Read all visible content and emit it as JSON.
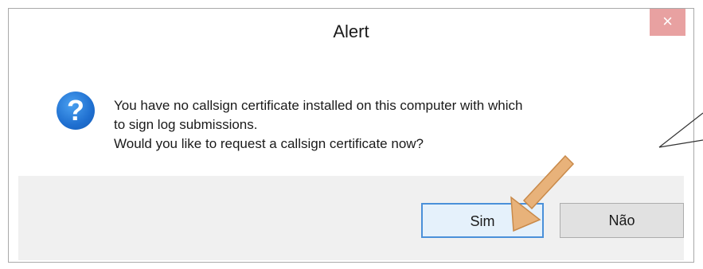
{
  "dialog": {
    "title": "Alert",
    "close_label": "×",
    "icon": "question-icon",
    "message_lines": [
      "You have no callsign certificate installed on this computer with which",
      "to sign log submissions.",
      "Would you like to request a callsign certificate now?"
    ],
    "buttons": {
      "yes": "Sim",
      "no": "Não"
    }
  },
  "colors": {
    "close_button": "#e8a1a1",
    "icon_blue": "#1f6fd0",
    "yes_border": "#4a90d9",
    "arrow": "#e8b27a"
  }
}
